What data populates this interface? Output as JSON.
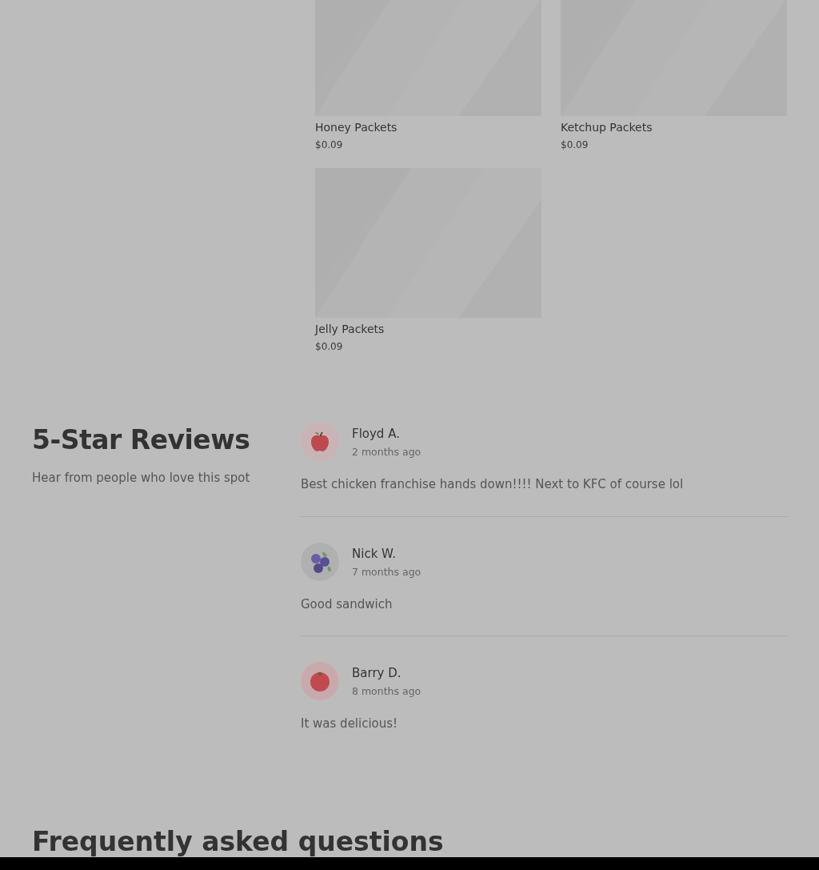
{
  "products": [
    {
      "name": "Honey Packets",
      "price": "$0.09"
    },
    {
      "name": "Ketchup Packets",
      "price": "$0.09"
    },
    {
      "name": "Jelly Packets",
      "price": "$0.09"
    }
  ],
  "reviews_section": {
    "title": "5-Star Reviews",
    "subtitle": "Hear from people who love this spot",
    "reviews": [
      {
        "kind": "apple",
        "name": "Floyd A.",
        "time": "2 months ago",
        "text": "Best chicken franchise hands down!!!! Next to KFC of course lol"
      },
      {
        "kind": "blueberry",
        "name": "Nick W.",
        "time": "7 months ago",
        "text": "Good sandwich"
      },
      {
        "kind": "tomato",
        "name": "Barry D.",
        "time": "8 months ago",
        "text": "It was delicious!"
      }
    ]
  },
  "faq": {
    "title": "Frequently asked questions"
  }
}
